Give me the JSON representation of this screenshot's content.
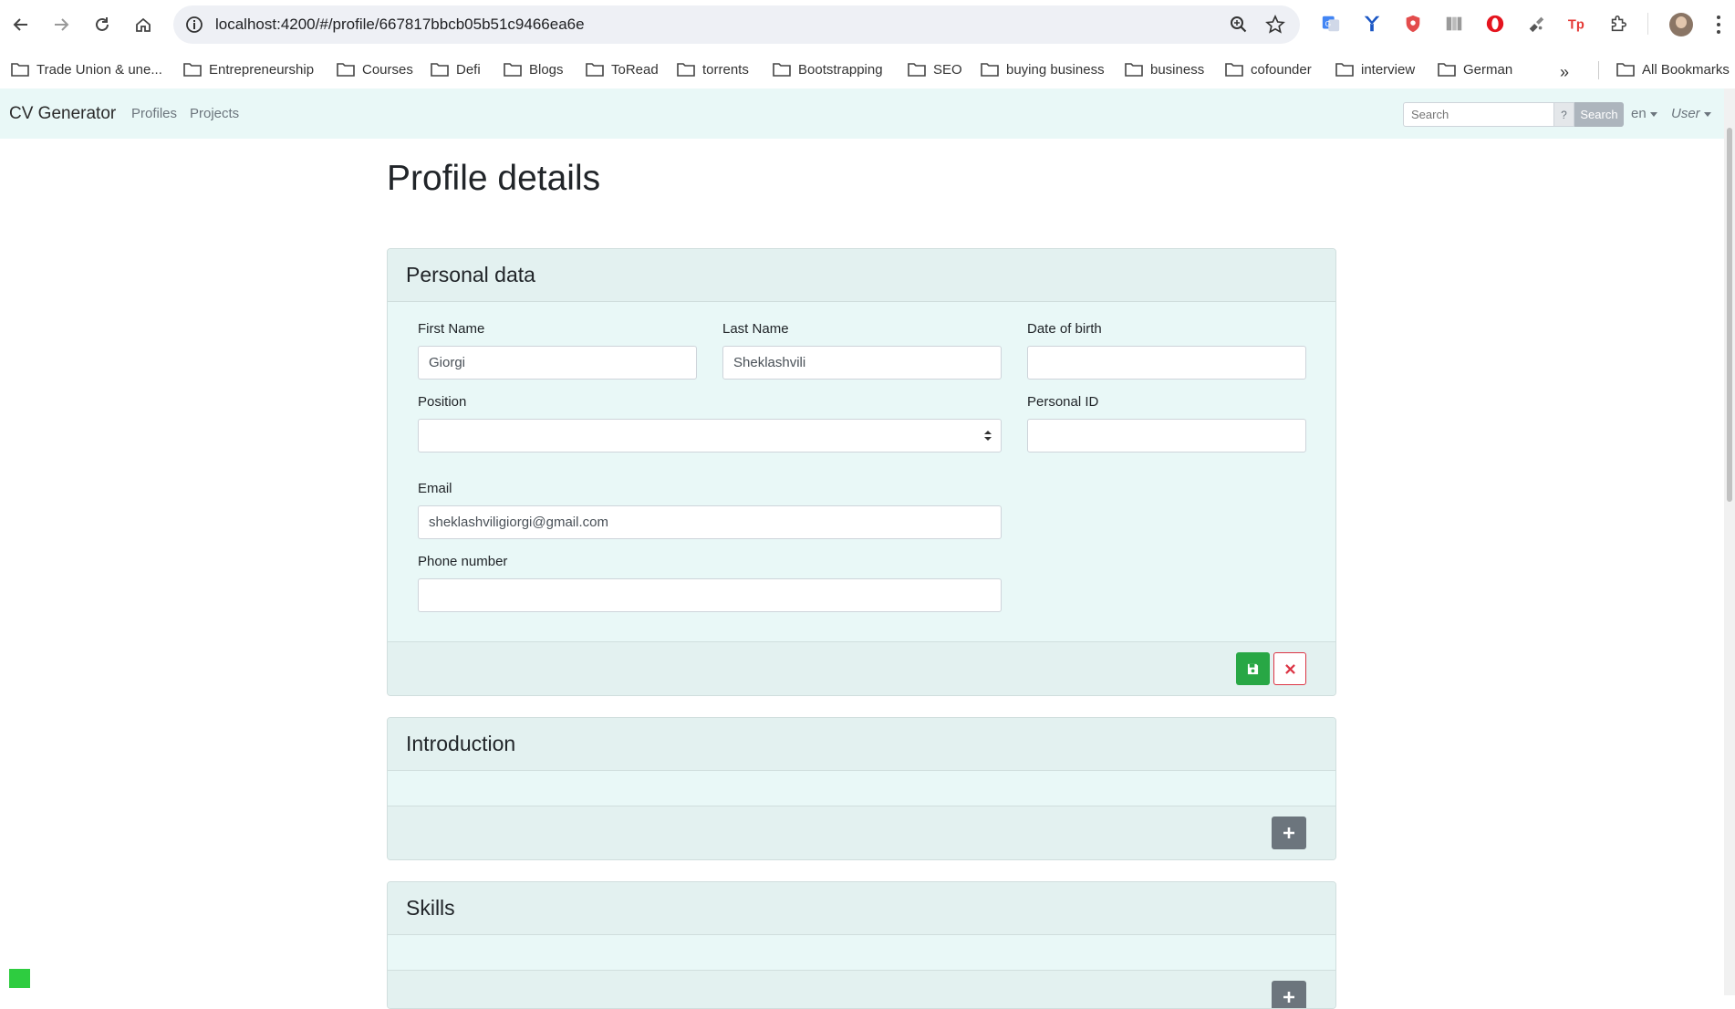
{
  "browser": {
    "url": "localhost:4200/#/profile/667817bbcb05b51c9466ea6e",
    "bookmarks": [
      "Trade Union & une...",
      "Entrepreneurship",
      "Courses",
      "Defi",
      "Blogs",
      "ToRead",
      "torrents",
      "Bootstrapping",
      "SEO",
      "buying business",
      "business",
      "cofounder",
      "interview",
      "German"
    ],
    "more_bookmarks": "»",
    "all_bookmarks": "All Bookmarks"
  },
  "navbar": {
    "brand": "CV Generator",
    "links": [
      "Profiles",
      "Projects"
    ],
    "search_placeholder": "Search",
    "search_help": "?",
    "search_button": "Search",
    "language": "en",
    "user": "User"
  },
  "page": {
    "title": "Profile details"
  },
  "personal_data": {
    "heading": "Personal data",
    "first_name": {
      "label": "First Name",
      "value": "Giorgi"
    },
    "last_name": {
      "label": "Last Name",
      "value": "Sheklashvili"
    },
    "date_of_birth": {
      "label": "Date of birth",
      "value": ""
    },
    "position": {
      "label": "Position",
      "value": ""
    },
    "personal_id": {
      "label": "Personal ID",
      "value": ""
    },
    "email": {
      "label": "Email",
      "value": "sheklashviligiorgi@gmail.com"
    },
    "phone": {
      "label": "Phone number",
      "value": ""
    }
  },
  "introduction": {
    "heading": "Introduction"
  },
  "skills": {
    "heading": "Skills"
  },
  "colors": {
    "save": "#28a745",
    "cancel": "#dc3545",
    "add": "#6c757d",
    "card_bg": "#e9f8f7"
  }
}
